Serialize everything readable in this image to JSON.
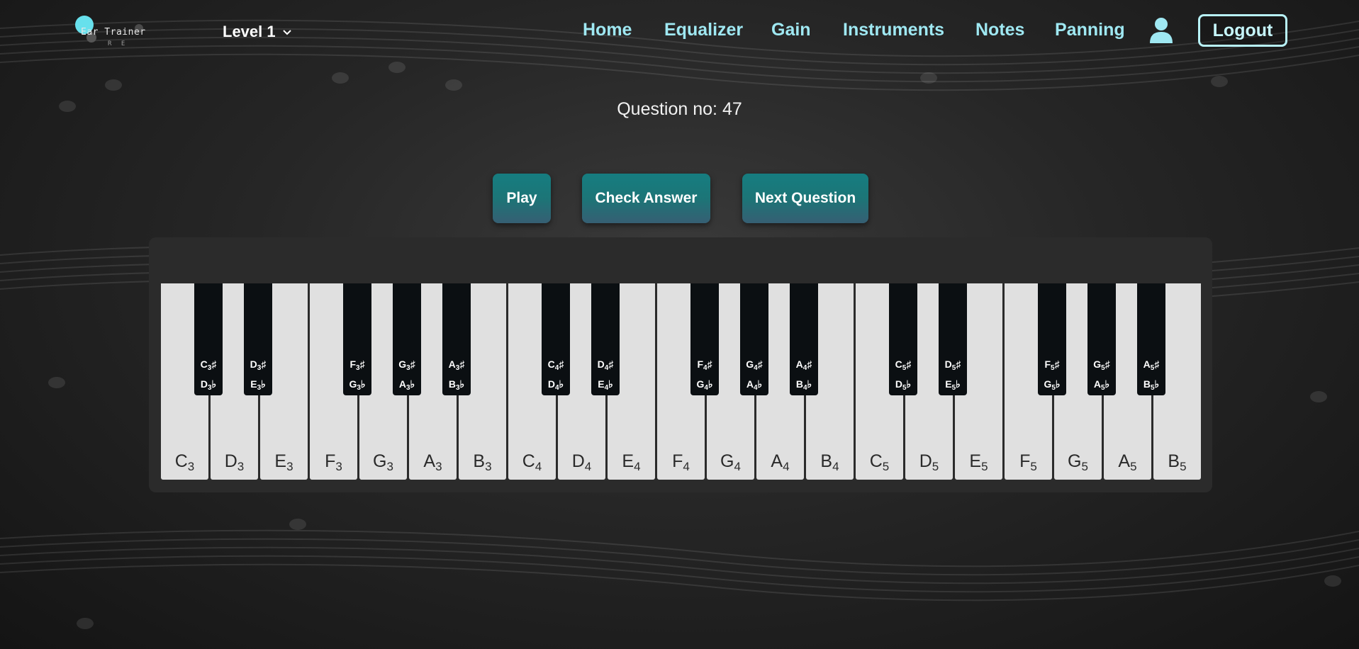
{
  "logo": {
    "name": "Ear Trainer",
    "sub": "R E"
  },
  "level": {
    "label": "Level 1",
    "icon": "chevron-down-icon"
  },
  "nav": [
    {
      "label": "Home"
    },
    {
      "label": "Equalizer"
    },
    {
      "label": "Gain"
    },
    {
      "label": "Instruments"
    },
    {
      "label": "Notes"
    },
    {
      "label": "Panning"
    }
  ],
  "user": {
    "icon": "user-icon"
  },
  "logout": {
    "label": "Logout"
  },
  "question": {
    "text": "Question no: 47"
  },
  "buttons": {
    "play": "Play",
    "check": "Check Answer",
    "next": "Next Question"
  },
  "piano": {
    "white_keys": [
      {
        "note": "C",
        "octave": "3"
      },
      {
        "note": "D",
        "octave": "3"
      },
      {
        "note": "E",
        "octave": "3"
      },
      {
        "note": "F",
        "octave": "3"
      },
      {
        "note": "G",
        "octave": "3"
      },
      {
        "note": "A",
        "octave": "3"
      },
      {
        "note": "B",
        "octave": "3"
      },
      {
        "note": "C",
        "octave": "4"
      },
      {
        "note": "D",
        "octave": "4"
      },
      {
        "note": "E",
        "octave": "4"
      },
      {
        "note": "F",
        "octave": "4"
      },
      {
        "note": "G",
        "octave": "4"
      },
      {
        "note": "A",
        "octave": "4"
      },
      {
        "note": "B",
        "octave": "4"
      },
      {
        "note": "C",
        "octave": "5"
      },
      {
        "note": "D",
        "octave": "5"
      },
      {
        "note": "E",
        "octave": "5"
      },
      {
        "note": "F",
        "octave": "5"
      },
      {
        "note": "G",
        "octave": "5"
      },
      {
        "note": "A",
        "octave": "5"
      },
      {
        "note": "B",
        "octave": "5"
      }
    ],
    "black_keys": [
      {
        "sharp": "C",
        "flat": "D",
        "octave": "3"
      },
      {
        "sharp": "D",
        "flat": "E",
        "octave": "3"
      },
      {
        "sharp": "F",
        "flat": "G",
        "octave": "3"
      },
      {
        "sharp": "G",
        "flat": "A",
        "octave": "3"
      },
      {
        "sharp": "A",
        "flat": "B",
        "octave": "3"
      },
      {
        "sharp": "C",
        "flat": "D",
        "octave": "4"
      },
      {
        "sharp": "D",
        "flat": "E",
        "octave": "4"
      },
      {
        "sharp": "F",
        "flat": "G",
        "octave": "4"
      },
      {
        "sharp": "G",
        "flat": "A",
        "octave": "4"
      },
      {
        "sharp": "A",
        "flat": "B",
        "octave": "4"
      },
      {
        "sharp": "C",
        "flat": "D",
        "octave": "5"
      },
      {
        "sharp": "D",
        "flat": "E",
        "octave": "5"
      },
      {
        "sharp": "F",
        "flat": "G",
        "octave": "5"
      },
      {
        "sharp": "G",
        "flat": "A",
        "octave": "5"
      },
      {
        "sharp": "A",
        "flat": "B",
        "octave": "5"
      }
    ],
    "sharp_symbol": "♯",
    "flat_symbol": "♭"
  },
  "colors": {
    "accent": "#67e0ec",
    "nav_text": "#9fe8f2",
    "button_top": "#167d80",
    "button_bottom": "#365f73",
    "piano_body": "#2b2b2b",
    "white_key": "#e0e0e0",
    "black_key": "#0b0f12"
  }
}
